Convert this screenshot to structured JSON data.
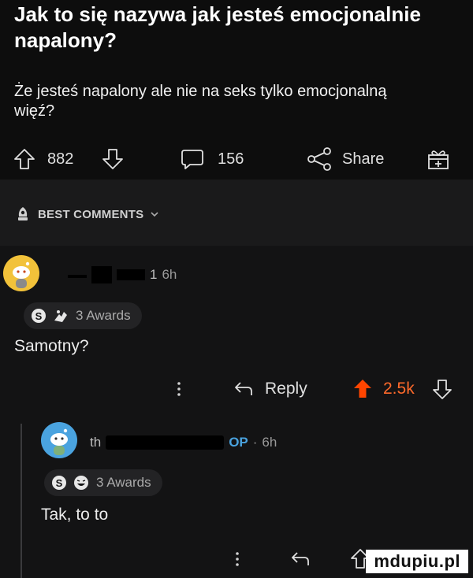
{
  "post": {
    "title": "Jak to się nazywa jak jesteś emocjonalnie napalony?",
    "body": "Że jesteś napalony ale nie na seks tylko emocjonalną więź?",
    "upvotes": "882",
    "comments": "156",
    "share_label": "Share"
  },
  "sort": {
    "label": "BEST COMMENTS"
  },
  "comments": [
    {
      "username_visible": "1",
      "time": "6h",
      "awards": "3 Awards",
      "text": "Samotny?",
      "reply_label": "Reply",
      "score": "2.5k"
    },
    {
      "username_visible": "th",
      "op_tag": "OP",
      "time": "6h",
      "awards": "3 Awards",
      "text": "Tak, to to"
    }
  ],
  "watermark": "mdupiu.pl",
  "colors": {
    "accent_upvote": "#ff4500",
    "background": "#131314",
    "header_bg": "#1a1a1b"
  }
}
